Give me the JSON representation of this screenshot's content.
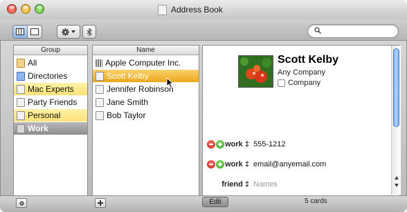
{
  "window": {
    "title": "Address Book"
  },
  "toolbar": {
    "view_buttons": [
      "split-view",
      "card-view"
    ],
    "action_menu": "gear-icon",
    "bluetooth": "bluetooth-icon"
  },
  "search": {
    "value": "",
    "placeholder": ""
  },
  "groups": {
    "header": "Group",
    "items": [
      {
        "label": "All",
        "state": "normal"
      },
      {
        "label": "Directories",
        "state": "normal"
      },
      {
        "label": "Mac Experts",
        "state": "highlight"
      },
      {
        "label": "Party Friends",
        "state": "normal"
      },
      {
        "label": "Personal",
        "state": "highlight"
      },
      {
        "label": "Work",
        "state": "selected"
      }
    ]
  },
  "names": {
    "header": "Name",
    "items": [
      {
        "label": "Apple Computer Inc.",
        "state": "normal"
      },
      {
        "label": "Scott Kelby",
        "state": "selected"
      },
      {
        "label": "Jennifer Robinson",
        "state": "normal"
      },
      {
        "label": "Jane Smith",
        "state": "normal"
      },
      {
        "label": "Bob Taylor",
        "state": "normal"
      }
    ]
  },
  "card": {
    "name": "Scott Kelby",
    "company": "Any Company",
    "company_checkbox_label": "Company",
    "fields": [
      {
        "label": "work",
        "value": "555-1212",
        "placeholder": false
      },
      {
        "label": "work",
        "value": "email@anyemail.com",
        "placeholder": false
      },
      {
        "label": "friend",
        "value": "Names",
        "placeholder": true
      }
    ]
  },
  "footer": {
    "edit_label": "Edit",
    "count_text": "5 cards"
  },
  "colors": {
    "selection_gold": "#e9a81a",
    "group_highlight": "#fbe178",
    "scroll_thumb": "#6aa2e8"
  }
}
